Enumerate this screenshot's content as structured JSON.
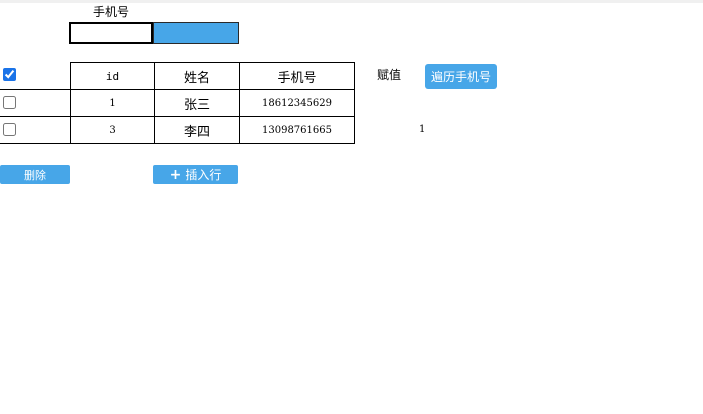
{
  "form": {
    "phone_label": "手机号",
    "phone_value": "",
    "button_label": ""
  },
  "table": {
    "select_all_checked": true,
    "headers": [
      "id",
      "姓名",
      "手机号"
    ],
    "rows": [
      {
        "checked": false,
        "id": "1",
        "name": "张三",
        "phone": "18612345629"
      },
      {
        "checked": false,
        "id": "3",
        "name": "李四",
        "phone": "13098761665"
      }
    ]
  },
  "side": {
    "assign_label": "赋值",
    "traverse_button": "遍历手机号",
    "assign_value": "1"
  },
  "actions": {
    "delete_button": "删除",
    "insert_button": "插入行",
    "insert_icon": "plus-icon"
  },
  "colors": {
    "accent": "#47a6e8",
    "checkbox_checked": "#1a73e8"
  }
}
